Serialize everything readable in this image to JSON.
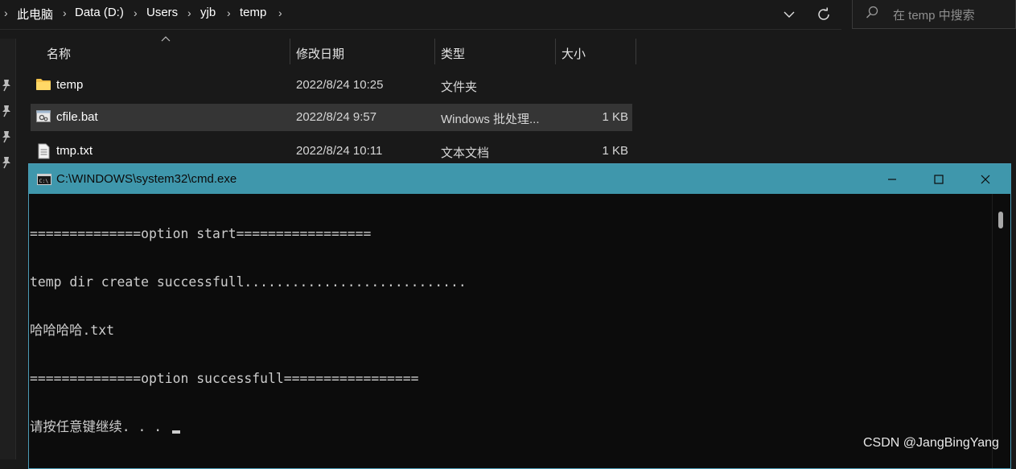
{
  "address_bar": {
    "crumbs": [
      "此电脑",
      "Data (D:)",
      "Users",
      "yjb",
      "temp"
    ],
    "search_placeholder": "在 temp 中搜索"
  },
  "file_list": {
    "columns": {
      "name": "名称",
      "date": "修改日期",
      "type": "类型",
      "size": "大小"
    },
    "rows": [
      {
        "name": "temp",
        "date": "2022/8/24 10:25",
        "type": "文件夹",
        "size": "",
        "icon": "folder-icon"
      },
      {
        "name": "cfile.bat",
        "date": "2022/8/24 9:57",
        "type": "Windows 批处理...",
        "size": "1 KB",
        "icon": "batch-file-icon",
        "selected": true
      },
      {
        "name": "tmp.txt",
        "date": "2022/8/24 10:11",
        "type": "文本文档",
        "size": "1 KB",
        "icon": "text-file-icon"
      }
    ]
  },
  "cmd_window": {
    "title": "C:\\WINDOWS\\system32\\cmd.exe",
    "lines": [
      "==============option start=================",
      "temp dir create successfull............................",
      "哈哈哈哈.txt",
      "==============option successfull=================",
      "请按任意键继续. . . "
    ],
    "accent_color": "#3f97ac"
  },
  "watermark": "CSDN @JangBingYang",
  "colors": {
    "background": "#191919",
    "selected_row": "#353535",
    "console_bg": "#0c0c0c",
    "console_text": "#cccccc"
  }
}
